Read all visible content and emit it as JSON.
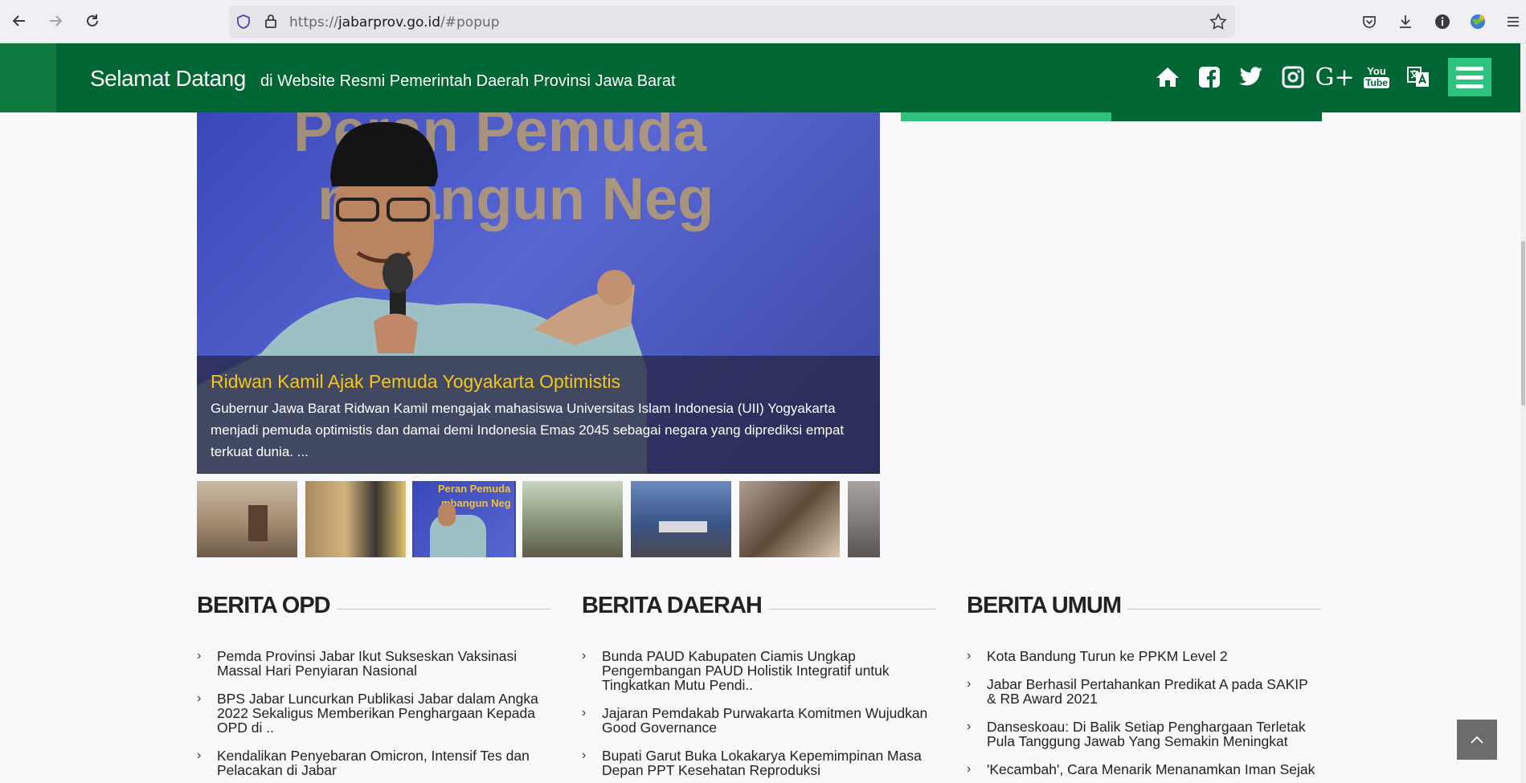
{
  "browser": {
    "url_prefix": "https://",
    "url_host": "jabarprov.go.id",
    "url_path": "/#popup"
  },
  "header": {
    "welcome_title": "Selamat Datang",
    "welcome_subtitle": "di Website Resmi Pemerintah Daerah Provinsi Jawa Barat",
    "social_icons": [
      "home-icon",
      "facebook-icon",
      "twitter-icon",
      "instagram-icon",
      "google-plus-icon",
      "youtube-icon",
      "translate-icon"
    ],
    "youtube_top": "You",
    "youtube_bottom": "Tube",
    "google_plus": "G+",
    "colors": {
      "primary": "#006633",
      "accent": "#2ec27e"
    }
  },
  "slider": {
    "bg_text_1": "Peran Pemuda",
    "bg_text_2": "mbangun Neg",
    "title": "Ridwan Kamil Ajak Pemuda Yogyakarta Optimistis",
    "description": "Gubernur Jawa Barat Ridwan Kamil mengajak mahasiswa Universitas Islam Indonesia (UII) Yogyakarta menjadi pemuda optimistis dan damai demi Indonesia Emas 2045 sebagai negara yang diprediksi empat terkuat dunia. ...",
    "thumb_text_1": "Peran Pemuda",
    "thumb_text_2": "mbangun Neg"
  },
  "columns": [
    {
      "title": "BERITA OPD",
      "items": [
        "Pemda Provinsi Jabar Ikut Sukseskan Vaksinasi Massal Hari Penyiaran Nasional",
        "BPS Jabar Luncurkan Publikasi Jabar dalam Angka 2022 Sekaligus Memberikan Penghargaan Kepada OPD di ..",
        "Kendalikan Penyebaran Omicron, Intensif Tes dan Pelacakan di Jabar"
      ]
    },
    {
      "title": "BERITA DAERAH",
      "items": [
        "Bunda PAUD Kabupaten Ciamis Ungkap Pengembangan PAUD Holistik Integratif untuk Tingkatkan Mutu Pendi..",
        "Jajaran Pemdakab Purwakarta Komitmen Wujudkan Good Governance",
        "Bupati Garut Buka Lokakarya Kepemimpinan Masa Depan PPT Kesehatan Reproduksi"
      ]
    },
    {
      "title": "BERITA UMUM",
      "items": [
        "Kota Bandung Turun ke PPKM Level 2",
        "Jabar Berhasil Pertahankan Predikat A pada SAKIP & RB Award 2021",
        "Danseskoau: Di Balik Setiap Penghargaan Terletak Pula Tanggung Jawab Yang Semakin Meningkat",
        "'Kecambah', Cara Menarik Menanamkan Iman Sejak"
      ]
    }
  ]
}
